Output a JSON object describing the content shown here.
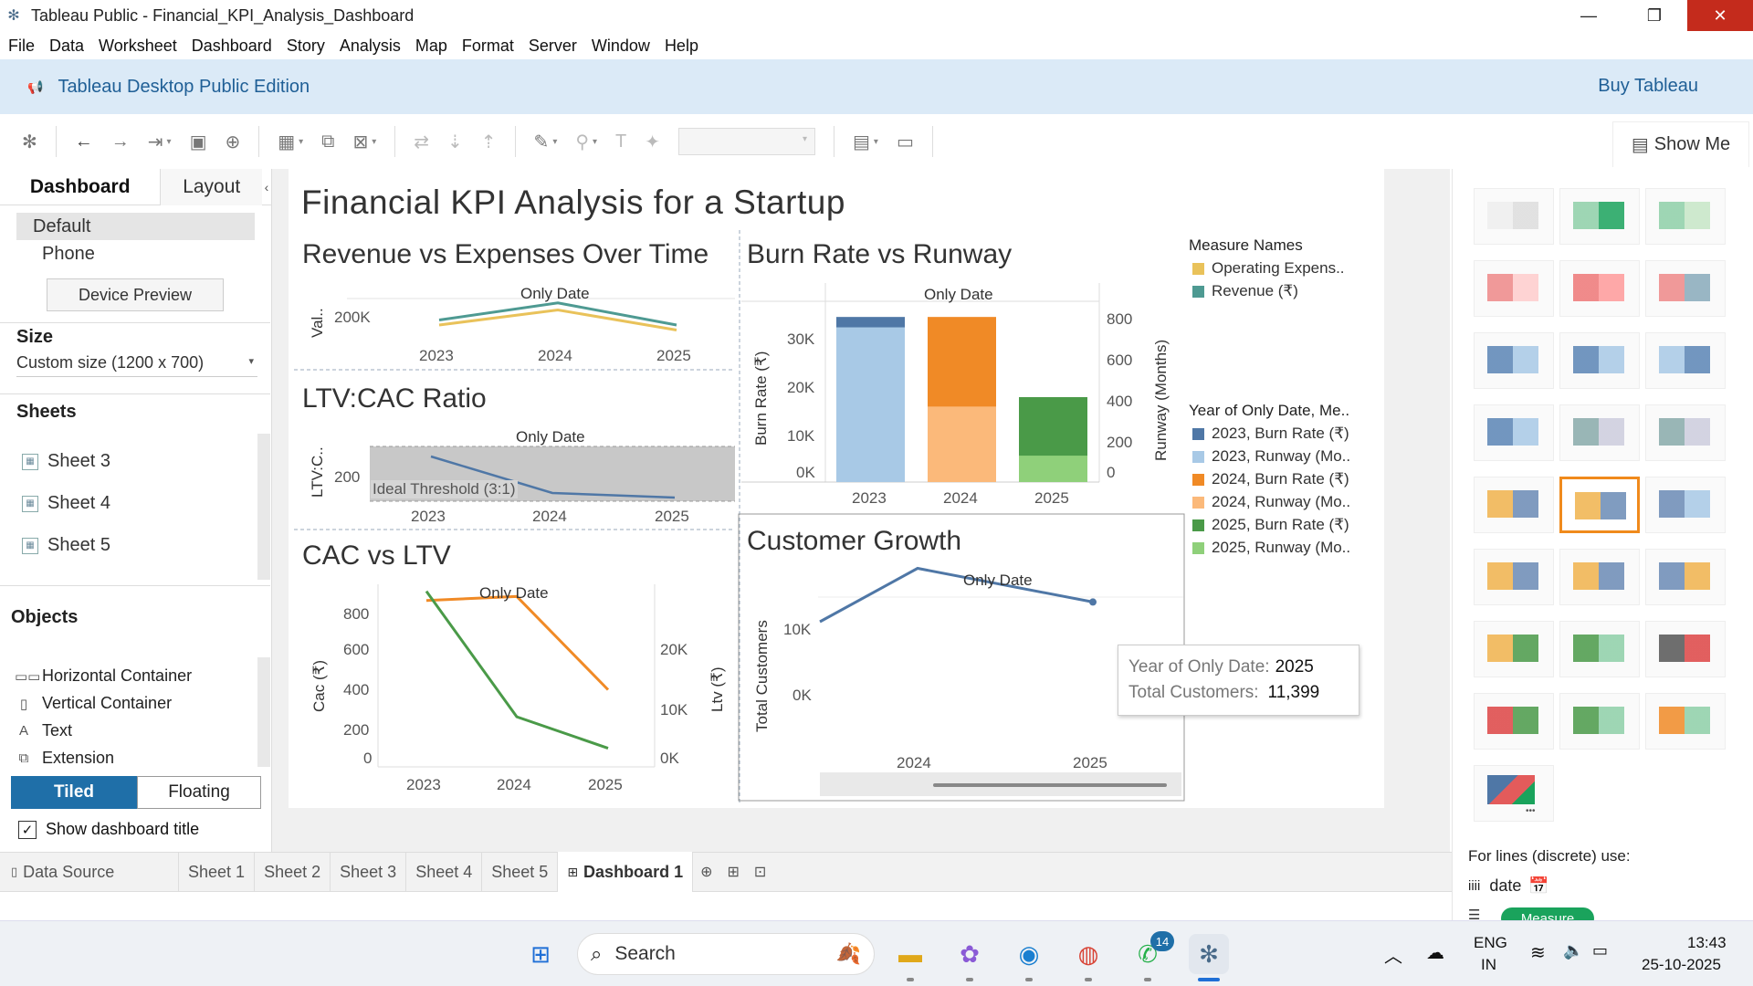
{
  "window": {
    "title": "Tableau Public - Financial_KPI_Analysis_Dashboard",
    "controls": [
      "minimize",
      "restore",
      "close"
    ]
  },
  "menu": [
    "File",
    "Data",
    "Worksheet",
    "Dashboard",
    "Story",
    "Analysis",
    "Map",
    "Format",
    "Server",
    "Window",
    "Help"
  ],
  "banner": {
    "edition": "Tableau Desktop Public Edition",
    "buy": "Buy Tableau"
  },
  "showme": {
    "label": "Show Me"
  },
  "leftpanel": {
    "tabs": [
      "Dashboard",
      "Layout"
    ],
    "devices": [
      "Default",
      "Phone"
    ],
    "device_preview": "Device Preview",
    "size_title": "Size",
    "size_value": "Custom size (1200 x 700)",
    "sheets_title": "Sheets",
    "sheets": [
      "Sheet 3",
      "Sheet 4",
      "Sheet 5"
    ],
    "objects_title": "Objects",
    "objects": [
      "Horizontal Container",
      "Vertical Container",
      "Text",
      "Extension"
    ],
    "tiled": "Tiled",
    "floating": "Floating",
    "show_title": "Show dashboard title"
  },
  "dashboard": {
    "title": "Financial KPI Analysis for a Startup"
  },
  "charts": {
    "rev": {
      "title": "Revenue vs Expenses Over Time",
      "header": "Only Date",
      "ylabel": "Val..",
      "ytick": "200K",
      "xticks": [
        "2023",
        "2024",
        "2025"
      ]
    },
    "ltv": {
      "title": "LTV:CAC Ratio",
      "header": "Only Date",
      "ylabel": "LTV:C..",
      "ytick": "200",
      "band_label": "Ideal Threshold (3:1)",
      "xticks": [
        "2023",
        "2024",
        "2025"
      ]
    },
    "cac": {
      "title": "CAC vs LTV",
      "header": "Only Date",
      "ylabel_left": "Cac (₹)",
      "ylabel_right": "Ltv (₹)",
      "yticks_left": [
        "800",
        "600",
        "400",
        "200",
        "0"
      ],
      "yticks_right": [
        "20K",
        "10K",
        "0K"
      ],
      "xticks": [
        "2023",
        "2024",
        "2025"
      ]
    },
    "burn": {
      "title": "Burn Rate vs Runway",
      "header": "Only Date",
      "ylabel_left": "Burn Rate (₹)",
      "ylabel_right": "Runway (Months)",
      "yticks_left": [
        "30K",
        "20K",
        "10K",
        "0K"
      ],
      "yticks_right": [
        "800",
        "600",
        "400",
        "200",
        "0"
      ],
      "xticks": [
        "2023",
        "2024",
        "2025"
      ]
    },
    "cust": {
      "title": "Customer Growth",
      "header": "Only Date",
      "ylabel": "Total Customers",
      "yticks": [
        "10K",
        "0K"
      ],
      "xticks": [
        "2024",
        "2025"
      ]
    }
  },
  "legends": {
    "measure_names": {
      "title": "Measure Names",
      "items": [
        {
          "label": "Operating Expens..",
          "color": "#e9c25a"
        },
        {
          "label": "Revenue (₹)",
          "color": "#4e9a92"
        }
      ]
    },
    "year": {
      "title": "Year of Only Date, Me..",
      "items": [
        {
          "label": "2023, Burn Rate (₹)",
          "color": "#4f77a6"
        },
        {
          "label": "2023, Runway (Mo..",
          "color": "#a8c9e6"
        },
        {
          "label": "2024, Burn Rate (₹)",
          "color": "#f08a26"
        },
        {
          "label": "2024, Runway (Mo..",
          "color": "#fbb97a"
        },
        {
          "label": "2025, Burn Rate (₹)",
          "color": "#4a9a48"
        },
        {
          "label": "2025, Runway (Mo..",
          "color": "#8fd07a"
        }
      ]
    }
  },
  "tooltip": {
    "year_label": "Year of Only Date:",
    "year_value": "2025",
    "cust_label": "Total Customers:",
    "cust_value": "11,399"
  },
  "showme_panel": {
    "footer": "For lines (discrete) use:",
    "date_label": "date",
    "measure_pill": "Measure"
  },
  "sheet_tabs": {
    "data_source": "Data Source",
    "tabs": [
      "Sheet 1",
      "Sheet 2",
      "Sheet 3",
      "Sheet 4",
      "Sheet 5",
      "Dashboard 1"
    ]
  },
  "taskbar": {
    "search": "Search",
    "lang": "ENG",
    "region": "IN",
    "time": "13:43",
    "date": "25-10-2025",
    "badge": "14"
  },
  "chart_data": [
    {
      "type": "line",
      "title": "Revenue vs Expenses Over Time",
      "x": [
        "2023",
        "2024",
        "2025"
      ],
      "series": [
        {
          "name": "Operating Expens..",
          "values": [
            190000,
            205000,
            185000
          ]
        },
        {
          "name": "Revenue (₹)",
          "values": [
            195000,
            212000,
            190000
          ]
        }
      ],
      "ylabel": "Val.."
    },
    {
      "type": "line",
      "title": "LTV:CAC Ratio",
      "x": [
        "2023",
        "2024",
        "2025"
      ],
      "series": [
        {
          "values": [
            220,
            180,
            175
          ]
        }
      ],
      "ylabel": "LTV:C..",
      "annotation": "Ideal Threshold (3:1)"
    },
    {
      "type": "line",
      "title": "CAC vs LTV",
      "x": [
        "2023",
        "2024",
        "2025"
      ],
      "series": [
        {
          "values": [
            780,
            800,
            340
          ]
        },
        {
          "values": [
            24000,
            6000,
            1500
          ]
        }
      ],
      "ylabel_left": "Cac (₹)",
      "ylabel_right": "Ltv (₹)"
    },
    {
      "type": "bar",
      "title": "Burn Rate vs Runway",
      "categories": [
        "2023",
        "2024",
        "2025"
      ],
      "series": [
        {
          "name": "Burn Rate (₹)",
          "values": [
            35000,
            35000,
            18000
          ]
        },
        {
          "name": "Runway (Months)",
          "values": [
            820,
            400,
            140
          ]
        }
      ],
      "ylabel_left": "Burn Rate (₹)",
      "ylabel_right": "Runway (Months)"
    },
    {
      "type": "line",
      "title": "Customer Growth",
      "x": [
        "2023",
        "2024",
        "2025"
      ],
      "series": [
        {
          "name": "Total Customers",
          "values": [
            9000,
            15500,
            11399
          ]
        }
      ],
      "ylabel": "Total Customers"
    }
  ]
}
